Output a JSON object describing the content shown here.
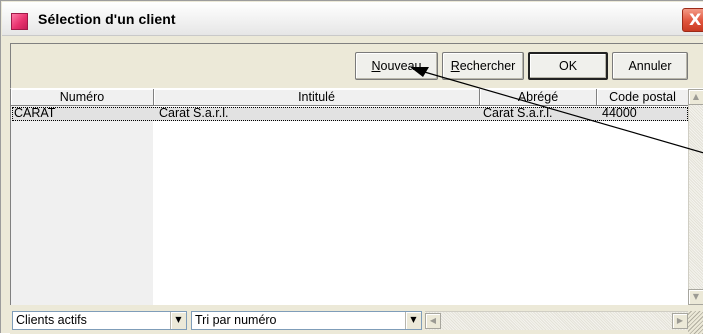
{
  "window": {
    "title": "Sélection d'un client",
    "close_glyph": "X",
    "icon": "app-icon"
  },
  "toolbar": {
    "new_label_underlined": "N",
    "new_label_rest": "ouveau",
    "search_label_underlined": "R",
    "search_label_rest": "echercher",
    "ok_label": "OK",
    "cancel_label": "Annuler"
  },
  "table": {
    "columns": [
      "Numéro",
      "Intitulé",
      "Abrégé",
      "Code postal"
    ],
    "rows": [
      {
        "numero": "CARAT",
        "intitule": "Carat S.a.r.l.",
        "abrege": "Carat S.a.r.l.",
        "code_postal": "44000"
      }
    ]
  },
  "filters": {
    "status_selected": "Clients actifs",
    "sort_selected": "Tri par numéro"
  },
  "icons": {
    "dropdown": "chevron-down-icon",
    "scroll_up": "triangle-up-icon",
    "scroll_down": "triangle-down-icon",
    "scroll_left": "triangle-left-icon",
    "scroll_right": "triangle-right-icon"
  },
  "colors": {
    "window_bg": "#ece9d8",
    "selected_row": "#e2e2e2",
    "close_button": "#e0543c",
    "app_icon": "#e8336e"
  }
}
